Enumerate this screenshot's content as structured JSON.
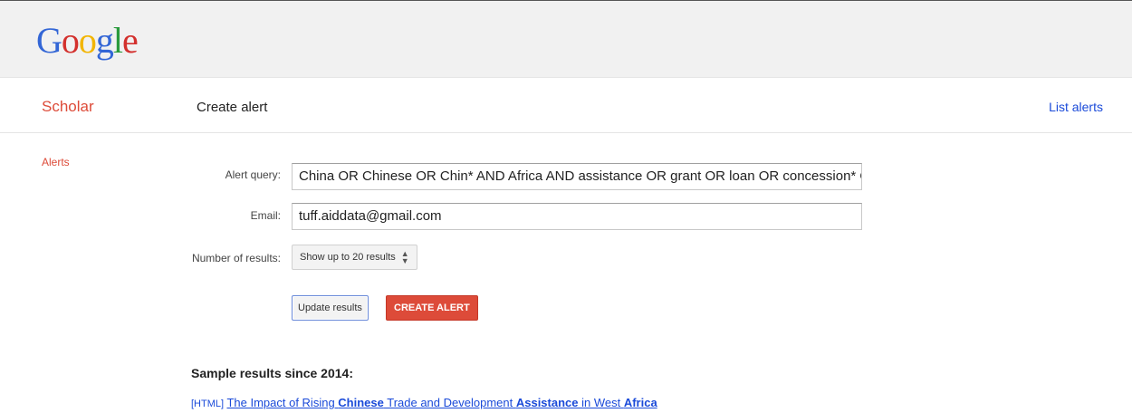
{
  "logo": {
    "letters": [
      "G",
      "o",
      "o",
      "g",
      "l",
      "e"
    ],
    "colors": [
      "#3366d6",
      "#d3302d",
      "#f2b500",
      "#3366d6",
      "#2a9a3c",
      "#d3302d"
    ]
  },
  "nav": {
    "brand": "Scholar",
    "title": "Create alert",
    "list_alerts": "List alerts"
  },
  "sidebar": {
    "alerts": "Alerts"
  },
  "form": {
    "query_label": "Alert query:",
    "query_value": "China OR Chinese OR Chin* AND Africa AND assistance OR grant OR loan OR concession* OF",
    "email_label": "Email:",
    "email_value": "tuff.aiddata@gmail.com",
    "results_label": "Number of results:",
    "results_value": "Show up to 20 results"
  },
  "buttons": {
    "update": "Update results",
    "create": "CREATE ALERT"
  },
  "sample": {
    "heading": "Sample results since 2014:",
    "tag": "[HTML]",
    "title_parts": [
      {
        "text": "The Impact of Rising ",
        "bold": false
      },
      {
        "text": "Chinese",
        "bold": true
      },
      {
        "text": " Trade and Development ",
        "bold": false
      },
      {
        "text": "Assistance",
        "bold": true
      },
      {
        "text": " in West ",
        "bold": false
      },
      {
        "text": "Africa",
        "bold": true
      }
    ]
  },
  "colors": {
    "brand_red": "#dd4b39",
    "link_blue": "#1a4ad9"
  }
}
